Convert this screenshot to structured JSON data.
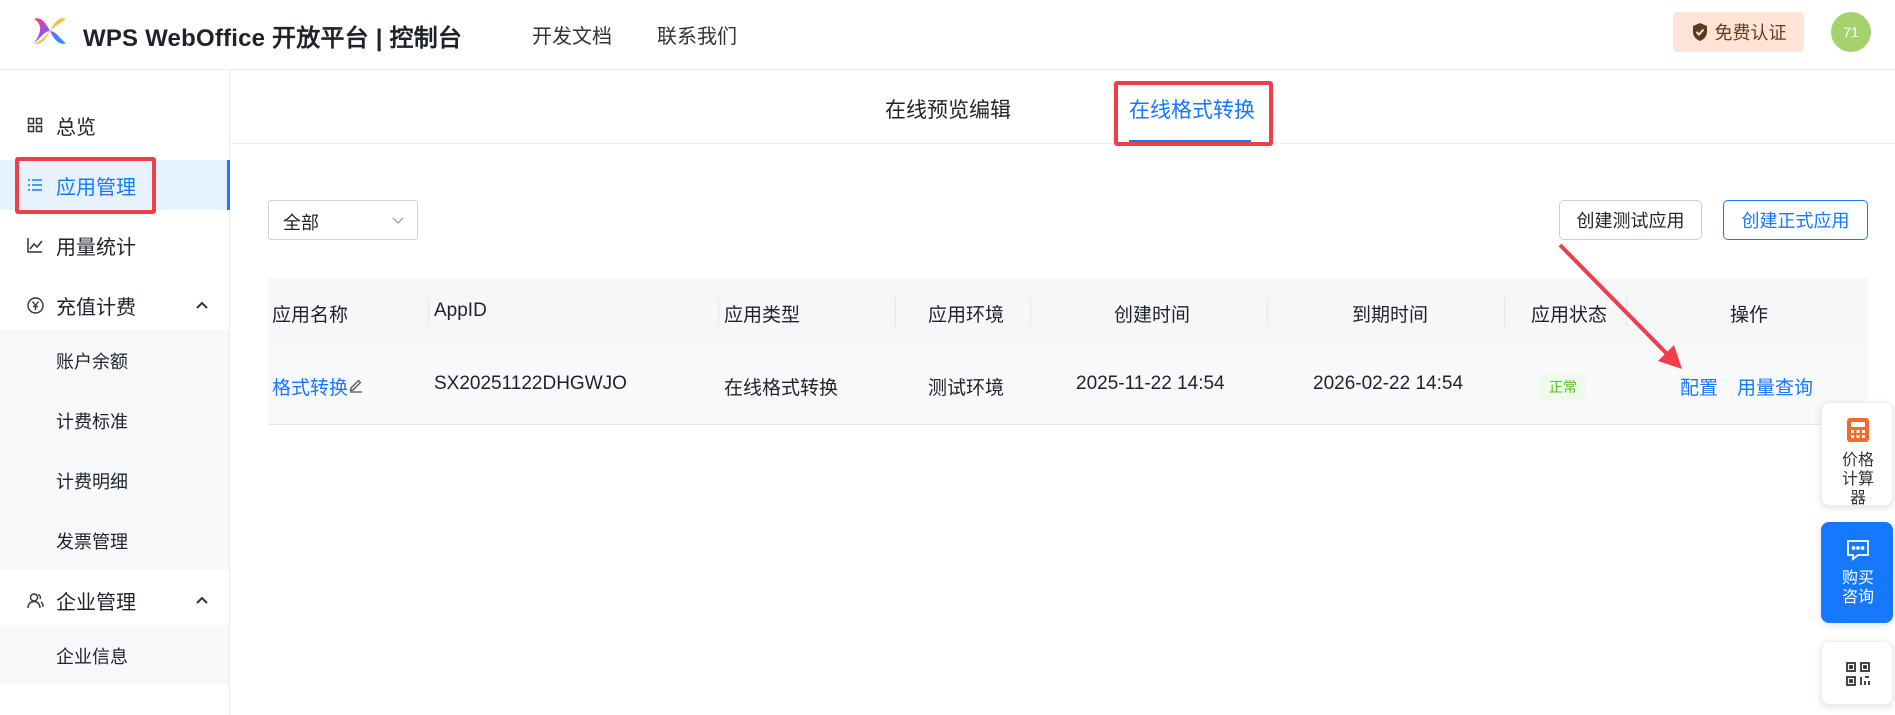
{
  "header": {
    "brand": "WPS WebOffice 开放平台 | 控制台",
    "nav": [
      "开发文档",
      "联系我们"
    ],
    "cert_button": "免费认证",
    "avatar_text": "71"
  },
  "sidebar": {
    "items": [
      {
        "label": "总览"
      },
      {
        "label": "应用管理"
      },
      {
        "label": "用量统计"
      },
      {
        "label": "充值计费"
      },
      {
        "label": "账户余额"
      },
      {
        "label": "计费标准"
      },
      {
        "label": "计费明细"
      },
      {
        "label": "发票管理"
      },
      {
        "label": "企业管理"
      },
      {
        "label": "企业信息"
      }
    ]
  },
  "tabs": [
    {
      "label": "在线预览编辑",
      "active": false
    },
    {
      "label": "在线格式转换",
      "active": true
    }
  ],
  "toolbar": {
    "filter_value": "全部",
    "create_test_button": "创建测试应用",
    "create_prod_button": "创建正式应用"
  },
  "table": {
    "columns": [
      "应用名称",
      "AppID",
      "应用类型",
      "应用环境",
      "创建时间",
      "到期时间",
      "应用状态",
      "操作"
    ],
    "rows": [
      {
        "name": "格式转换",
        "app_id": "SX20251122DHGWJO",
        "type": "在线格式转换",
        "env": "测试环境",
        "created": "2025-11-22 14:54",
        "expires": "2026-02-22 14:54",
        "status": "正常",
        "actions": [
          "配置",
          "用量查询"
        ]
      }
    ]
  },
  "floating": {
    "calculator": "价格计算器",
    "consult": "购买咨询"
  },
  "colors": {
    "accent": "#1677ff",
    "highlight_box": "#ee3e4c",
    "status_ok": "#52c41a"
  }
}
